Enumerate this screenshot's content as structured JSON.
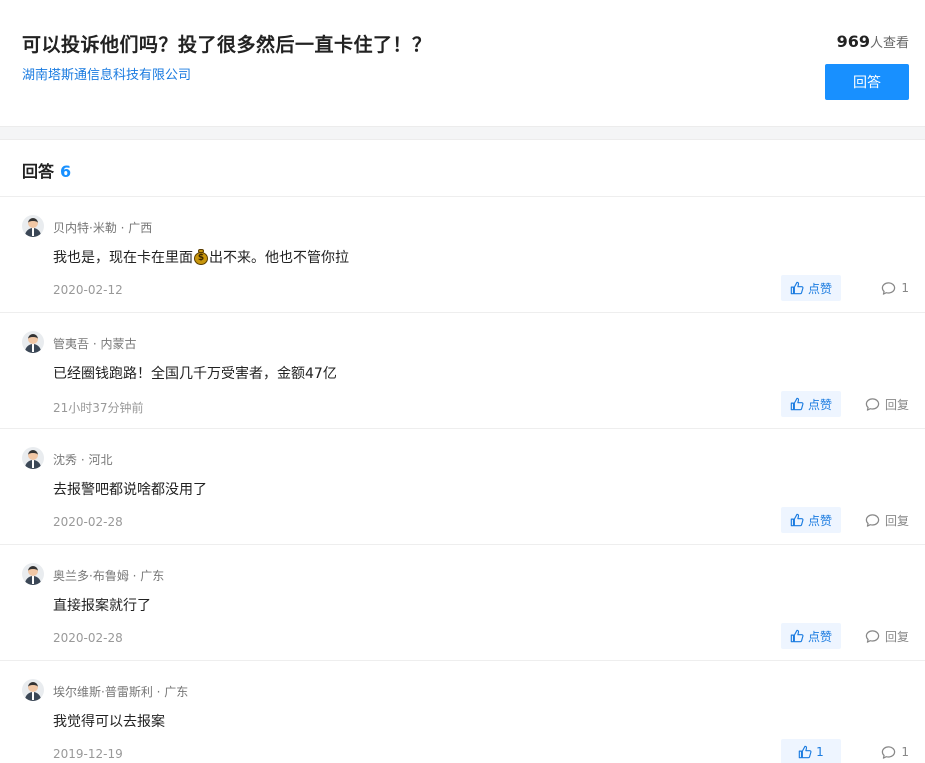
{
  "question": {
    "title": "可以投诉他们吗？投了很多然后一直卡住了！？",
    "company": "湖南塔斯通信息科技有限公司",
    "view_count": "969",
    "view_suffix": "人查看",
    "answer_button": "回答"
  },
  "answers_header": {
    "label": "回答",
    "count": "6"
  },
  "icons": {
    "like": "thumbs-up-icon",
    "reply": "comment-bubble-icon",
    "avatar": "user-avatar-icon",
    "emoji": "money-bag-icon"
  },
  "colors": {
    "accent": "#1890ff",
    "link": "#1a7be0",
    "like_bg": "#eef5ff"
  },
  "answers": [
    {
      "user": "贝内特·米勒 · 广西",
      "content_before": "我也是，现在卡在里面",
      "content_after": "出不来。他也不管你拉",
      "date": "2020-02-12",
      "like_label": "点赞",
      "reply_label": "1"
    },
    {
      "user": "管夷吾 · 内蒙古",
      "content": "已经圈钱跑路！全国几千万受害者，金额47亿",
      "date": "21小时37分钟前",
      "like_label": "点赞",
      "reply_label": "回复"
    },
    {
      "user": "沈秀 · 河北",
      "content": "去报警吧都说啥都没用了",
      "date": "2020-02-28",
      "like_label": "点赞",
      "reply_label": "回复"
    },
    {
      "user": "奥兰多·布鲁姆 · 广东",
      "content": "直接报案就行了",
      "date": "2020-02-28",
      "like_label": "点赞",
      "reply_label": "回复"
    },
    {
      "user": "埃尔维斯·普雷斯利 · 广东",
      "content": "我觉得可以去报案",
      "date": "2019-12-19",
      "like_label": "1",
      "reply_label": "1"
    }
  ]
}
